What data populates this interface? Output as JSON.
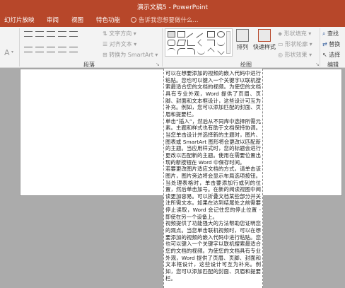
{
  "window": {
    "title": "演示文稿5 - PowerPoint"
  },
  "tabs": [
    {
      "label": "幻灯片放映"
    },
    {
      "label": "审阅"
    },
    {
      "label": "视图"
    },
    {
      "label": "特色功能"
    }
  ],
  "tell_me": {
    "placeholder": "告诉我您想要做什么..."
  },
  "ribbon": {
    "paragraph": {
      "text_direction": "文字方向",
      "align_text": "对齐文本",
      "convert_smartart": "转换为 SmartArt",
      "group_label": "段落"
    },
    "drawing": {
      "arrange": "排列",
      "quick_styles": "快速样式",
      "shape_fill": "形状填充",
      "shape_outline": "形状轮廓",
      "shape_effects": "形状效果",
      "group_label": "绘图"
    },
    "editing": {
      "find": "查找",
      "replace": "替换",
      "select": "选择",
      "group_label": "编辑"
    },
    "font_partial": {
      "size_letter": "A"
    }
  },
  "textbox": {
    "paragraphs": [
      "可以在想要添加的视频的嵌入代码中进行粘贴。您也可以键入一个关键字以联机搜索最适合您的文档的视频。为使您的文档具有专业外观，Word 提供了页眉、页脚、封面和文本框设计，这些设计可互为补充。例如，您可以添加匹配的封面、页眉和提要栏。",
      "单击“插入”，然后从不同库中选择所需元素。主题和样式也有助于文档保持协调。当您单击设计并选择新的主题时，图片、图表或 SmartArt 图形将会更改以匹配新的主题。当应用样式时，您的标题会进行更改以匹配新的主题。使用在需要位置出现的新按钮在 Word 中保存时间。",
      "若要更改图片适应文档的方式，请单击该图片，图片旁边将会显示布局选项按钮。当处理表格时，单击要添加行或列的位置，然后单击加号。在新的阅读视图中阅读更加容易。可以折叠文档某些部分并关注所需文本。如果在达到结尾处之前需要停止读取，Word 会记住您的停止位置 - 即使在另一个设备上。",
      "视频提供了功能强大的方法帮助您证明您的观点。当您单击联机视频时，可以在想要添加的视频的嵌入代码中进行粘贴。您也可以键入一个关键字以联机搜索最适合您的文档的视频。为使您的文档具有专业外观，Word 提供了页眉、页脚、封面和文本框设计，这些设计可互为补充。例如，您可以添加匹配的封面、页眉和提要栏。"
    ]
  }
}
